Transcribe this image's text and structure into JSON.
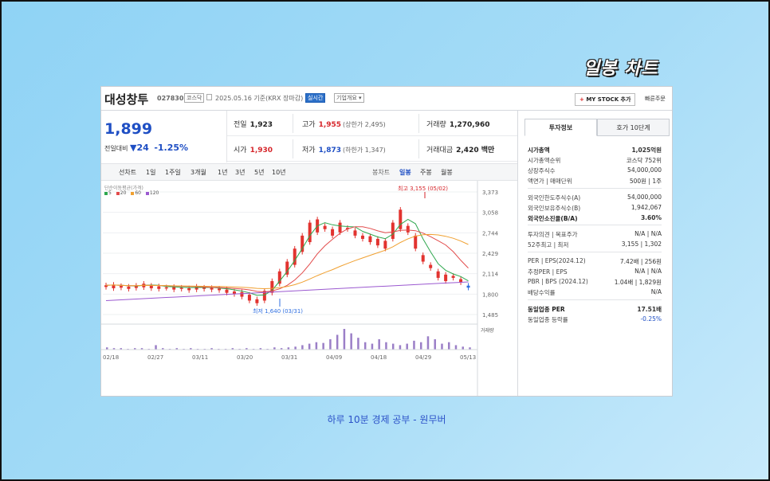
{
  "banner_title": "일봉 차트",
  "caption": "하루 10분 경제 공부 - 원무버",
  "header": {
    "stock_name": "대성창투",
    "stock_code": "027830",
    "market_tag": "코스닥",
    "date_label": "2025.05.16 기준(KRX 장마감)",
    "realtime_tag": "실시간",
    "company_tag": "기업개요 ▾",
    "mystock_label": "MY STOCK 추가",
    "quick_order": "빠른주문"
  },
  "price": {
    "current": "1,899",
    "change_label": "전일대비",
    "change_arrow": "▼",
    "change_abs": "24",
    "change_pct": "-1.25%"
  },
  "quotes": {
    "prev_label": "전일",
    "prev": "1,923",
    "high_label": "고가",
    "high": "1,955",
    "high_sub": "(상한가 2,495)",
    "volume_label": "거래량",
    "volume": "1,270,960",
    "open_label": "시가",
    "open": "1,930",
    "low_label": "저가",
    "low": "1,873",
    "low_sub": "(하한가 1,347)",
    "amount_label": "거래대금",
    "amount": "2,420 백만"
  },
  "toolbar": {
    "periods": [
      "선차트",
      "1일",
      "1주일",
      "3개월",
      "1년",
      "3년",
      "5년",
      "10년"
    ],
    "candle_types": [
      "봉차트",
      "일봉",
      "주봉",
      "월봉"
    ],
    "active_candle": "일봉"
  },
  "chart_data": {
    "type": "candlestick",
    "legend_title": "단순이동평균(가격)",
    "legend": [
      {
        "name": "5",
        "color": "#2fa84f"
      },
      {
        "name": "20",
        "color": "#e24b4b"
      },
      {
        "name": "60",
        "color": "#f0a030"
      },
      {
        "name": "120",
        "color": "#9b59d0"
      }
    ],
    "y_ticks": [
      "3,373",
      "3,058",
      "2,744",
      "2,429",
      "2,114",
      "1,800",
      "1,485"
    ],
    "x_ticks": [
      "02/18",
      "02/27",
      "03/11",
      "03/20",
      "03/31",
      "04/09",
      "04/18",
      "04/29",
      "05/13"
    ],
    "ylim": [
      1485,
      3373
    ],
    "high_annotation": "최고 3,155 (05/02)",
    "low_annotation": "최저 1,640 (03/31)",
    "volume_label": "거래량",
    "candles": [
      1910,
      1935,
      1890,
      1945,
      1900,
      1925,
      1880,
      1915,
      1895,
      1930,
      1905,
      1960,
      1890,
      1930,
      1880,
      1920,
      1895,
      1905,
      1870,
      1910,
      1880,
      1900,
      1860,
      1890,
      1870,
      1915,
      1880,
      1900,
      1870,
      1895,
      1860,
      1885,
      1820,
      1870,
      1800,
      1840,
      1760,
      1830,
      1700,
      1790,
      1660,
      1720,
      1700,
      1850,
      1820,
      2000,
      1960,
      2150,
      2100,
      2300,
      2250,
      2500,
      2450,
      2700,
      2600,
      2900,
      2750,
      2950,
      2800,
      2850,
      2700,
      2800,
      2750,
      2900,
      2800,
      2820,
      2700,
      2780,
      2650,
      2700,
      2600,
      2690,
      2550,
      2650,
      2500,
      2620,
      2650,
      2900,
      2800,
      3100,
      2750,
      2850,
      2500,
      2700,
      2300,
      2400,
      2200,
      2250,
      2050,
      2150,
      2000,
      2100,
      2050,
      2080,
      1980,
      2030,
      1930,
      1899
    ],
    "volume": [
      3,
      2,
      2,
      1,
      2,
      2,
      1,
      6,
      2,
      1,
      2,
      1,
      2,
      1,
      1,
      2,
      1,
      1,
      2,
      1,
      2,
      1,
      2,
      1,
      3,
      2,
      3,
      4,
      6,
      8,
      10,
      9,
      14,
      20,
      28,
      22,
      16,
      10,
      8,
      14,
      10,
      8,
      6,
      8,
      12,
      10,
      18,
      14,
      8,
      10,
      6,
      4,
      3
    ]
  },
  "right_panel": {
    "tabs": [
      "투자정보",
      "호가 10단계"
    ],
    "rows": [
      {
        "label": "시가총액",
        "value": "1,025억원",
        "bold": true
      },
      {
        "label": "시가총액순위",
        "value": "코스닥 752위"
      },
      {
        "label": "상장주식수",
        "value": "54,000,000"
      },
      {
        "label": "액면가 | 매매단위",
        "value": "500원 | 1주"
      },
      {
        "label": "외국인한도주식수(A)",
        "value": "54,000,000"
      },
      {
        "label": "외국인보유주식수(B)",
        "value": "1,942,067"
      },
      {
        "label": "외국인소진율(B/A)",
        "value": "3.60%",
        "bold": true
      },
      {
        "label": "투자의견 | 목표주가",
        "value": "N/A | N/A"
      },
      {
        "label": "52주최고 | 최저",
        "value": "3,155 | 1,302"
      },
      {
        "label": "PER | EPS(2024.12)",
        "value": "7.42배 | 256원"
      },
      {
        "label": "추정PER | EPS",
        "value": "N/A | N/A"
      },
      {
        "label": "PBR | BPS (2024.12)",
        "value": "1.04배 | 1,829원"
      },
      {
        "label": "배당수익률",
        "value": "N/A"
      },
      {
        "label": "동일업종 PER",
        "value": "17.51배",
        "bold": true
      },
      {
        "label": "동일업종 등락률",
        "value": "-0.25%",
        "blue": true
      }
    ]
  }
}
